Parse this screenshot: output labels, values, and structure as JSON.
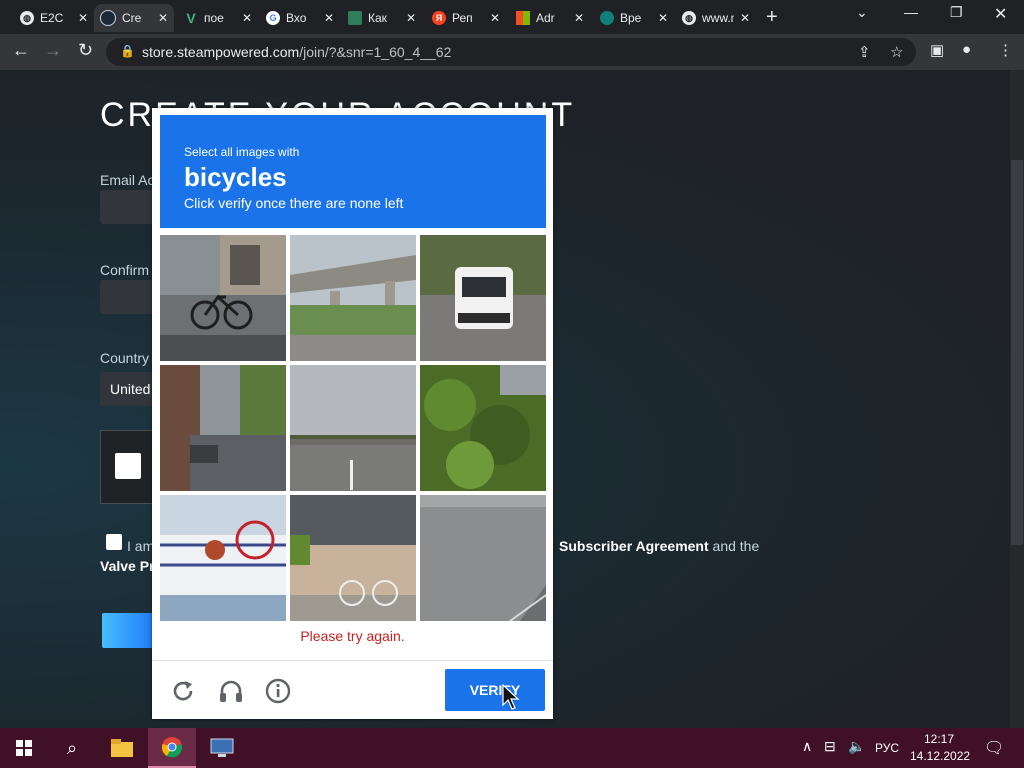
{
  "browser": {
    "tabs": [
      {
        "title": "E2C",
        "icon": "globe-icon",
        "color": "#5f6368"
      },
      {
        "title": "Cre",
        "icon": "steam-icon",
        "color": "#1b2838",
        "active": true
      },
      {
        "title": "пое",
        "icon": "v-icon",
        "color": "#2e7d5b"
      },
      {
        "title": "Вхо",
        "icon": "google-icon",
        "color": "#4285f4"
      },
      {
        "title": "Как",
        "icon": "money-icon",
        "color": "#2e7d5b"
      },
      {
        "title": "Реп",
        "icon": "yandex-icon",
        "color": "#fc3f1d"
      },
      {
        "title": "Adr",
        "icon": "microsoft-icon",
        "color": "#f25022"
      },
      {
        "title": "Вре",
        "icon": "clock-icon",
        "color": "#12807a"
      },
      {
        "title": "www.na",
        "icon": "globe-icon",
        "color": "#5f6368"
      }
    ],
    "url_host": "store.steampowered.com",
    "url_path": "/join/?&snr=1_60_4__62"
  },
  "page": {
    "title": "CREATE YOUR ACCOUNT",
    "email_label": "Email Ac",
    "confirm_label": "Confirm",
    "country_label": "Country",
    "country_value": "United",
    "terms_prefix": "I am",
    "terms_link1": "Subscriber Agreement",
    "terms_middle": "and the",
    "terms_line2": "Valve Pr"
  },
  "recaptcha": {
    "instruction": "Select all images with",
    "target": "bicycles",
    "subtext": "Click verify once there are none left",
    "error": "Please try again.",
    "verify_label": "VERIFY",
    "tiles": [
      "bicycle-by-building",
      "overpass-bridge",
      "white-van",
      "residential-street",
      "highway-overpass",
      "green-bushes",
      "bicycle-on-balcony",
      "bicycle-by-wall",
      "empty-road"
    ]
  },
  "taskbar": {
    "lang": "РУС",
    "time": "12:17",
    "date": "14.12.2022"
  }
}
